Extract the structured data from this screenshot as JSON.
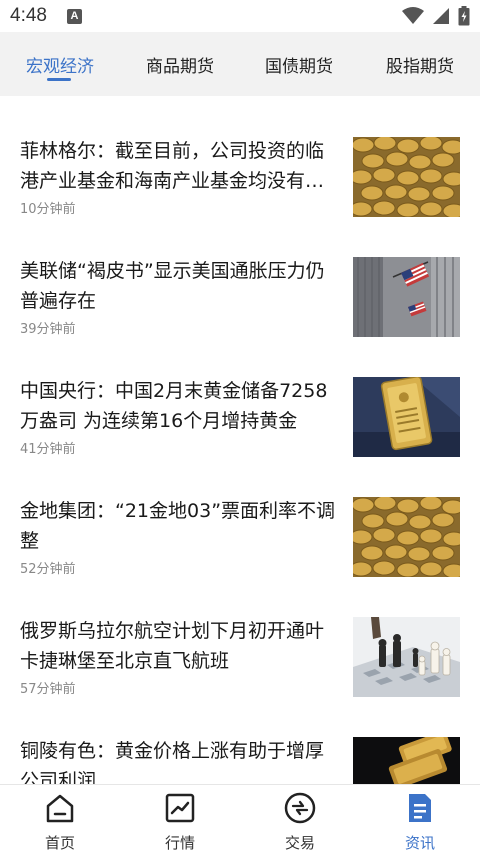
{
  "status": {
    "time": "4:48",
    "notif_letter": "A"
  },
  "tabs": [
    {
      "label": "宏观经济",
      "active": true
    },
    {
      "label": "商品期货",
      "active": false
    },
    {
      "label": "国债期货",
      "active": false
    },
    {
      "label": "股指期货",
      "active": false
    }
  ],
  "news": [
    {
      "title": "菲林格尔：截至目前，公司投资的临港产业基金和海南产业基金均没有投资",
      "time": "10分钟前",
      "thumb": "gold-coins"
    },
    {
      "title": "美联储“褐皮书”显示美国通胀压力仍普遍存在",
      "time": "39分钟前",
      "thumb": "us-flag-building"
    },
    {
      "title": "中国央行：中国2月末黄金储备7258万盎司 为连续第16个月增持黄金",
      "time": "41分钟前",
      "thumb": "gold-bar"
    },
    {
      "title": "金地集团：“21金地03”票面利率不调整",
      "time": "52分钟前",
      "thumb": "gold-coins"
    },
    {
      "title": "俄罗斯乌拉尔航空计划下月初开通叶卡捷琳堡至北京直飞航班",
      "time": "57分钟前",
      "thumb": "chess"
    },
    {
      "title": "铜陵有色：黄金价格上涨有助于增厚公司利润",
      "time": "",
      "thumb": "gold-bars-dark"
    }
  ],
  "nav": [
    {
      "label": "首页",
      "icon": "home-icon",
      "active": false
    },
    {
      "label": "行情",
      "icon": "chart-icon",
      "active": false
    },
    {
      "label": "交易",
      "icon": "trade-icon",
      "active": false
    },
    {
      "label": "资讯",
      "icon": "news-icon",
      "active": true
    }
  ],
  "colors": {
    "accent": "#3c73c8",
    "tab_bg": "#f2f2f2"
  }
}
